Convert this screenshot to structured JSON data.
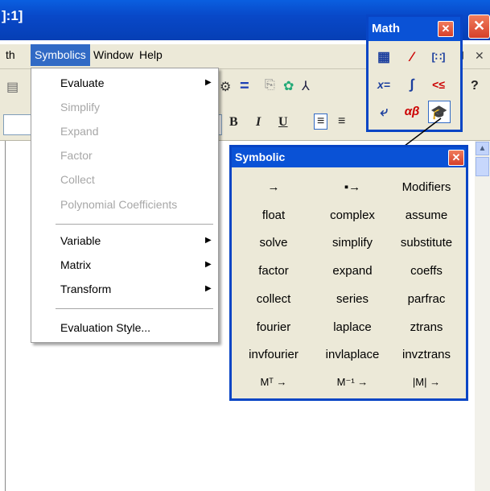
{
  "window": {
    "title_fragment": "]:1]",
    "close_glyph": "✕"
  },
  "menubar": {
    "items": [
      "th",
      "Symbolics",
      "Window",
      "Help"
    ],
    "active": "Symbolics"
  },
  "toolbar": {
    "icons": [
      "gear-icon",
      "equals-icon",
      "copy-icon",
      "component-icon",
      "tree-icon",
      "help-icon"
    ],
    "format_buttons": [
      "B",
      "I",
      "U"
    ]
  },
  "symbolics_menu": {
    "items": [
      {
        "label": "Evaluate",
        "enabled": true,
        "submenu": true
      },
      {
        "label": "Simplify",
        "enabled": false
      },
      {
        "label": "Expand",
        "enabled": false
      },
      {
        "label": "Factor",
        "enabled": false
      },
      {
        "label": "Collect",
        "enabled": false
      },
      {
        "label": "Polynomial Coefficients",
        "enabled": false
      },
      {
        "label": "Variable",
        "enabled": true,
        "submenu": true
      },
      {
        "label": "Matrix",
        "enabled": true,
        "submenu": true
      },
      {
        "label": "Transform",
        "enabled": true,
        "submenu": true
      },
      {
        "label": "Evaluation Style...",
        "enabled": true
      }
    ]
  },
  "math_palette": {
    "title": "Math",
    "close_glyph": "✕",
    "icons": [
      "calculator-icon",
      "graph-icon",
      "matrix-icon",
      "evaluation-icon",
      "calculus-icon",
      "boolean-icon",
      "programming-icon",
      "greek-icon",
      "symbolic-keyword-icon"
    ],
    "glyphs": [
      "▦",
      "⁄",
      "[∷]",
      "x=",
      "∫",
      "<≤",
      "⤶",
      "αβ",
      "🎓"
    ]
  },
  "symbolic_palette": {
    "title": "Symbolic",
    "close_glyph": "✕",
    "buttons": [
      [
        "→",
        "▪→",
        "Modifiers"
      ],
      [
        "float",
        "complex",
        "assume"
      ],
      [
        "solve",
        "simplify",
        "substitute"
      ],
      [
        "factor",
        "expand",
        "coeffs"
      ],
      [
        "collect",
        "series",
        "parfrac"
      ],
      [
        "fourier",
        "laplace",
        "ztrans"
      ],
      [
        "invfourier",
        "invlaplace",
        "invztrans"
      ],
      [
        "Mᵀ →",
        "M⁻¹ →",
        "|M| →"
      ]
    ]
  }
}
